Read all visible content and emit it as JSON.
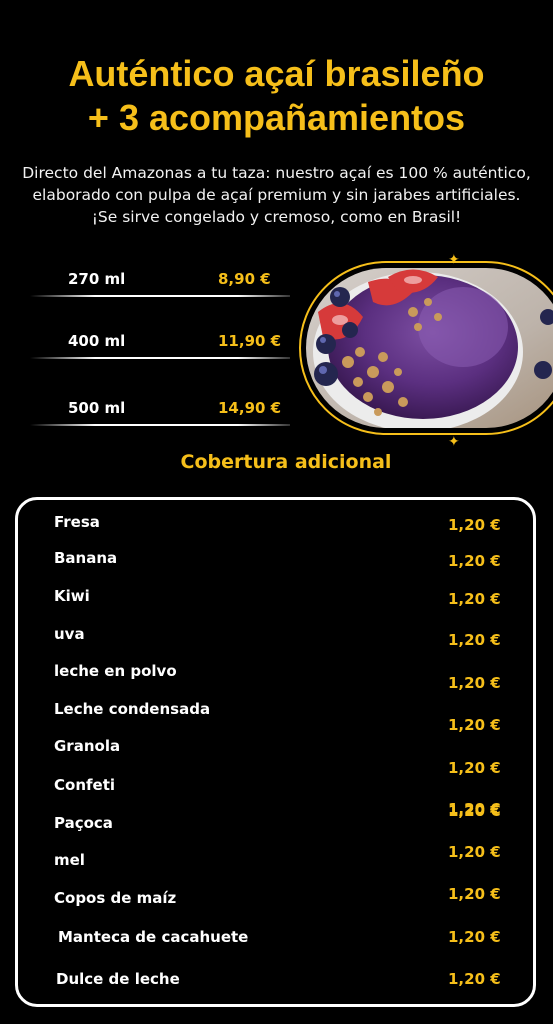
{
  "title_lines": [
    "Auténtico açaí brasileño",
    "+ 3 acompañamientos"
  ],
  "description": "Directo del Amazonas a tu taza: nuestro açaí es 100 % auténtico, elaborado con pulpa de açaí premium y sin jarabes artificiales. ¡Se sirve congelado y cremoso, como en Brasil!",
  "sizes": [
    {
      "size": "270 ml",
      "price": "8,90 €"
    },
    {
      "size": "400 ml",
      "price": "11,90 €"
    },
    {
      "size": "500 ml",
      "price": "14,90 €"
    }
  ],
  "photo": {
    "subject": "açaí bowl with strawberries, blueberries and granola"
  },
  "toppings_title": "Cobertura adicional",
  "toppings": [
    {
      "name": "Fresa",
      "price": "1,20 €"
    },
    {
      "name": "Banana",
      "price": "1,20 €"
    },
    {
      "name": "Kiwi",
      "price": "1,20 €"
    },
    {
      "name": "uva",
      "price": "1,20 €"
    },
    {
      "name": "leche en polvo",
      "price": "1,20 €"
    },
    {
      "name": "Leche condensada",
      "price": "1,20 €"
    },
    {
      "name": "Granola",
      "price": "1,20 €"
    },
    {
      "name": "Confeti",
      "price": "1,20 €"
    },
    {
      "name": "Paçoca",
      "price": "1,20 €"
    },
    {
      "name": "mel",
      "price": "1,20 €"
    },
    {
      "name": "Copos de maíz",
      "price": "1,20 €"
    },
    {
      "name": "Manteca de cacahuete",
      "price": "1,20 €"
    },
    {
      "name": "Dulce de leche",
      "price": "1,20 €"
    }
  ],
  "colors": {
    "accent": "#f6bf1a",
    "background": "#000000",
    "text": "#ffffff"
  }
}
